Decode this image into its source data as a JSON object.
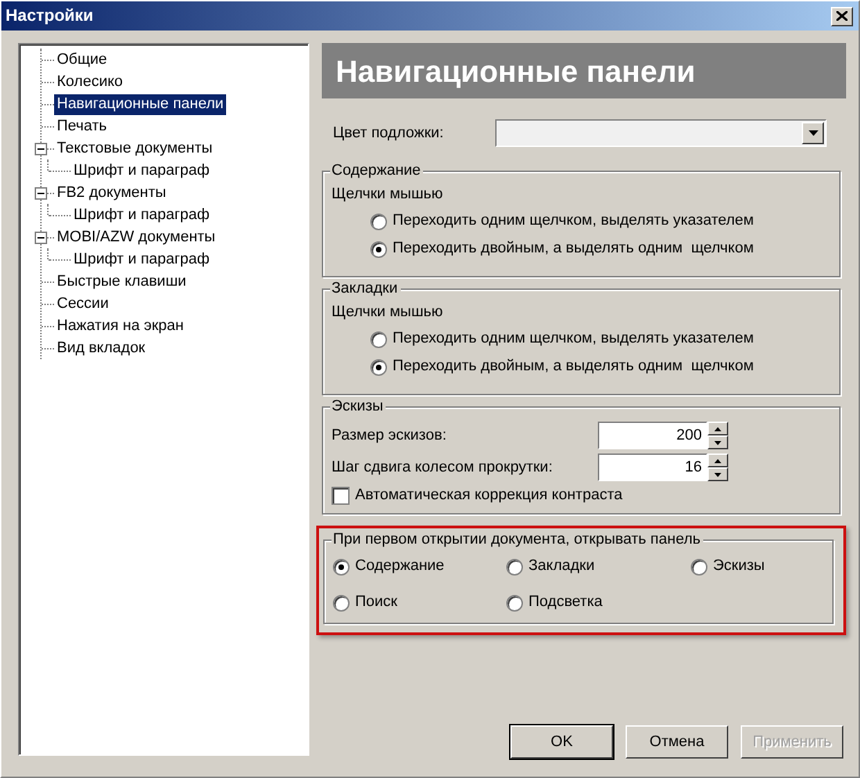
{
  "window": {
    "title": "Настройки"
  },
  "tree": [
    {
      "label": "Общие",
      "selected": false
    },
    {
      "label": "Колесико",
      "selected": false
    },
    {
      "label": "Навигационные панели",
      "selected": true
    },
    {
      "label": "Печать",
      "selected": false
    },
    {
      "label": "Текстовые документы",
      "selected": false,
      "expanded": true,
      "children": [
        {
          "label": "Шрифт и параграф",
          "selected": false
        }
      ]
    },
    {
      "label": "FB2 документы",
      "selected": false,
      "expanded": true,
      "children": [
        {
          "label": "Шрифт и параграф",
          "selected": false
        }
      ]
    },
    {
      "label": "MOBI/AZW документы",
      "selected": false,
      "expanded": true,
      "children": [
        {
          "label": "Шрифт и параграф",
          "selected": false
        }
      ]
    },
    {
      "label": "Быстрые клавиши",
      "selected": false
    },
    {
      "label": "Сессии",
      "selected": false
    },
    {
      "label": "Нажатия на экран",
      "selected": false
    },
    {
      "label": "Вид вкладок",
      "selected": false
    }
  ],
  "page": {
    "title": "Навигационные панели"
  },
  "background_color": {
    "label": "Цвет подложки:"
  },
  "groups": [
    {
      "kind": "radios",
      "title": "Содержание",
      "caption": "Щелчки мышью",
      "options": [
        {
          "label": "Переходить одним щелчком, выделять указателем",
          "selected": false
        },
        {
          "label": "Переходить двойным, а выделять одним  щелчком",
          "selected": true
        }
      ]
    },
    {
      "kind": "radios",
      "title": "Закладки",
      "caption": "Щелчки мышью",
      "options": [
        {
          "label": "Переходить одним щелчком, выделять указателем",
          "selected": false
        },
        {
          "label": "Переходить двойным, а выделять одним  щелчком",
          "selected": true
        }
      ]
    },
    {
      "kind": "thumbnails",
      "title": "Эскизы",
      "spinners": [
        {
          "label": "Размер эскизов:",
          "value": "200"
        },
        {
          "label": "Шаг сдвига колесом прокрутки:",
          "value": "16"
        }
      ],
      "checkbox": {
        "label": "Автоматическая коррекция контраста",
        "checked": false
      }
    },
    {
      "kind": "grid",
      "title": "При первом открытии документа, открывать панель",
      "highlighted": true,
      "options": [
        {
          "label": "Содержание",
          "selected": true
        },
        {
          "label": "Закладки",
          "selected": false
        },
        {
          "label": "Эскизы",
          "selected": false
        },
        {
          "label": "Поиск",
          "selected": false
        },
        {
          "label": "Подсветка",
          "selected": false
        }
      ]
    }
  ],
  "buttons": [
    {
      "label": "OK",
      "default": true,
      "disabled": false
    },
    {
      "label": "Отмена",
      "default": false,
      "disabled": false
    },
    {
      "label": "Применить",
      "default": false,
      "disabled": true
    }
  ]
}
